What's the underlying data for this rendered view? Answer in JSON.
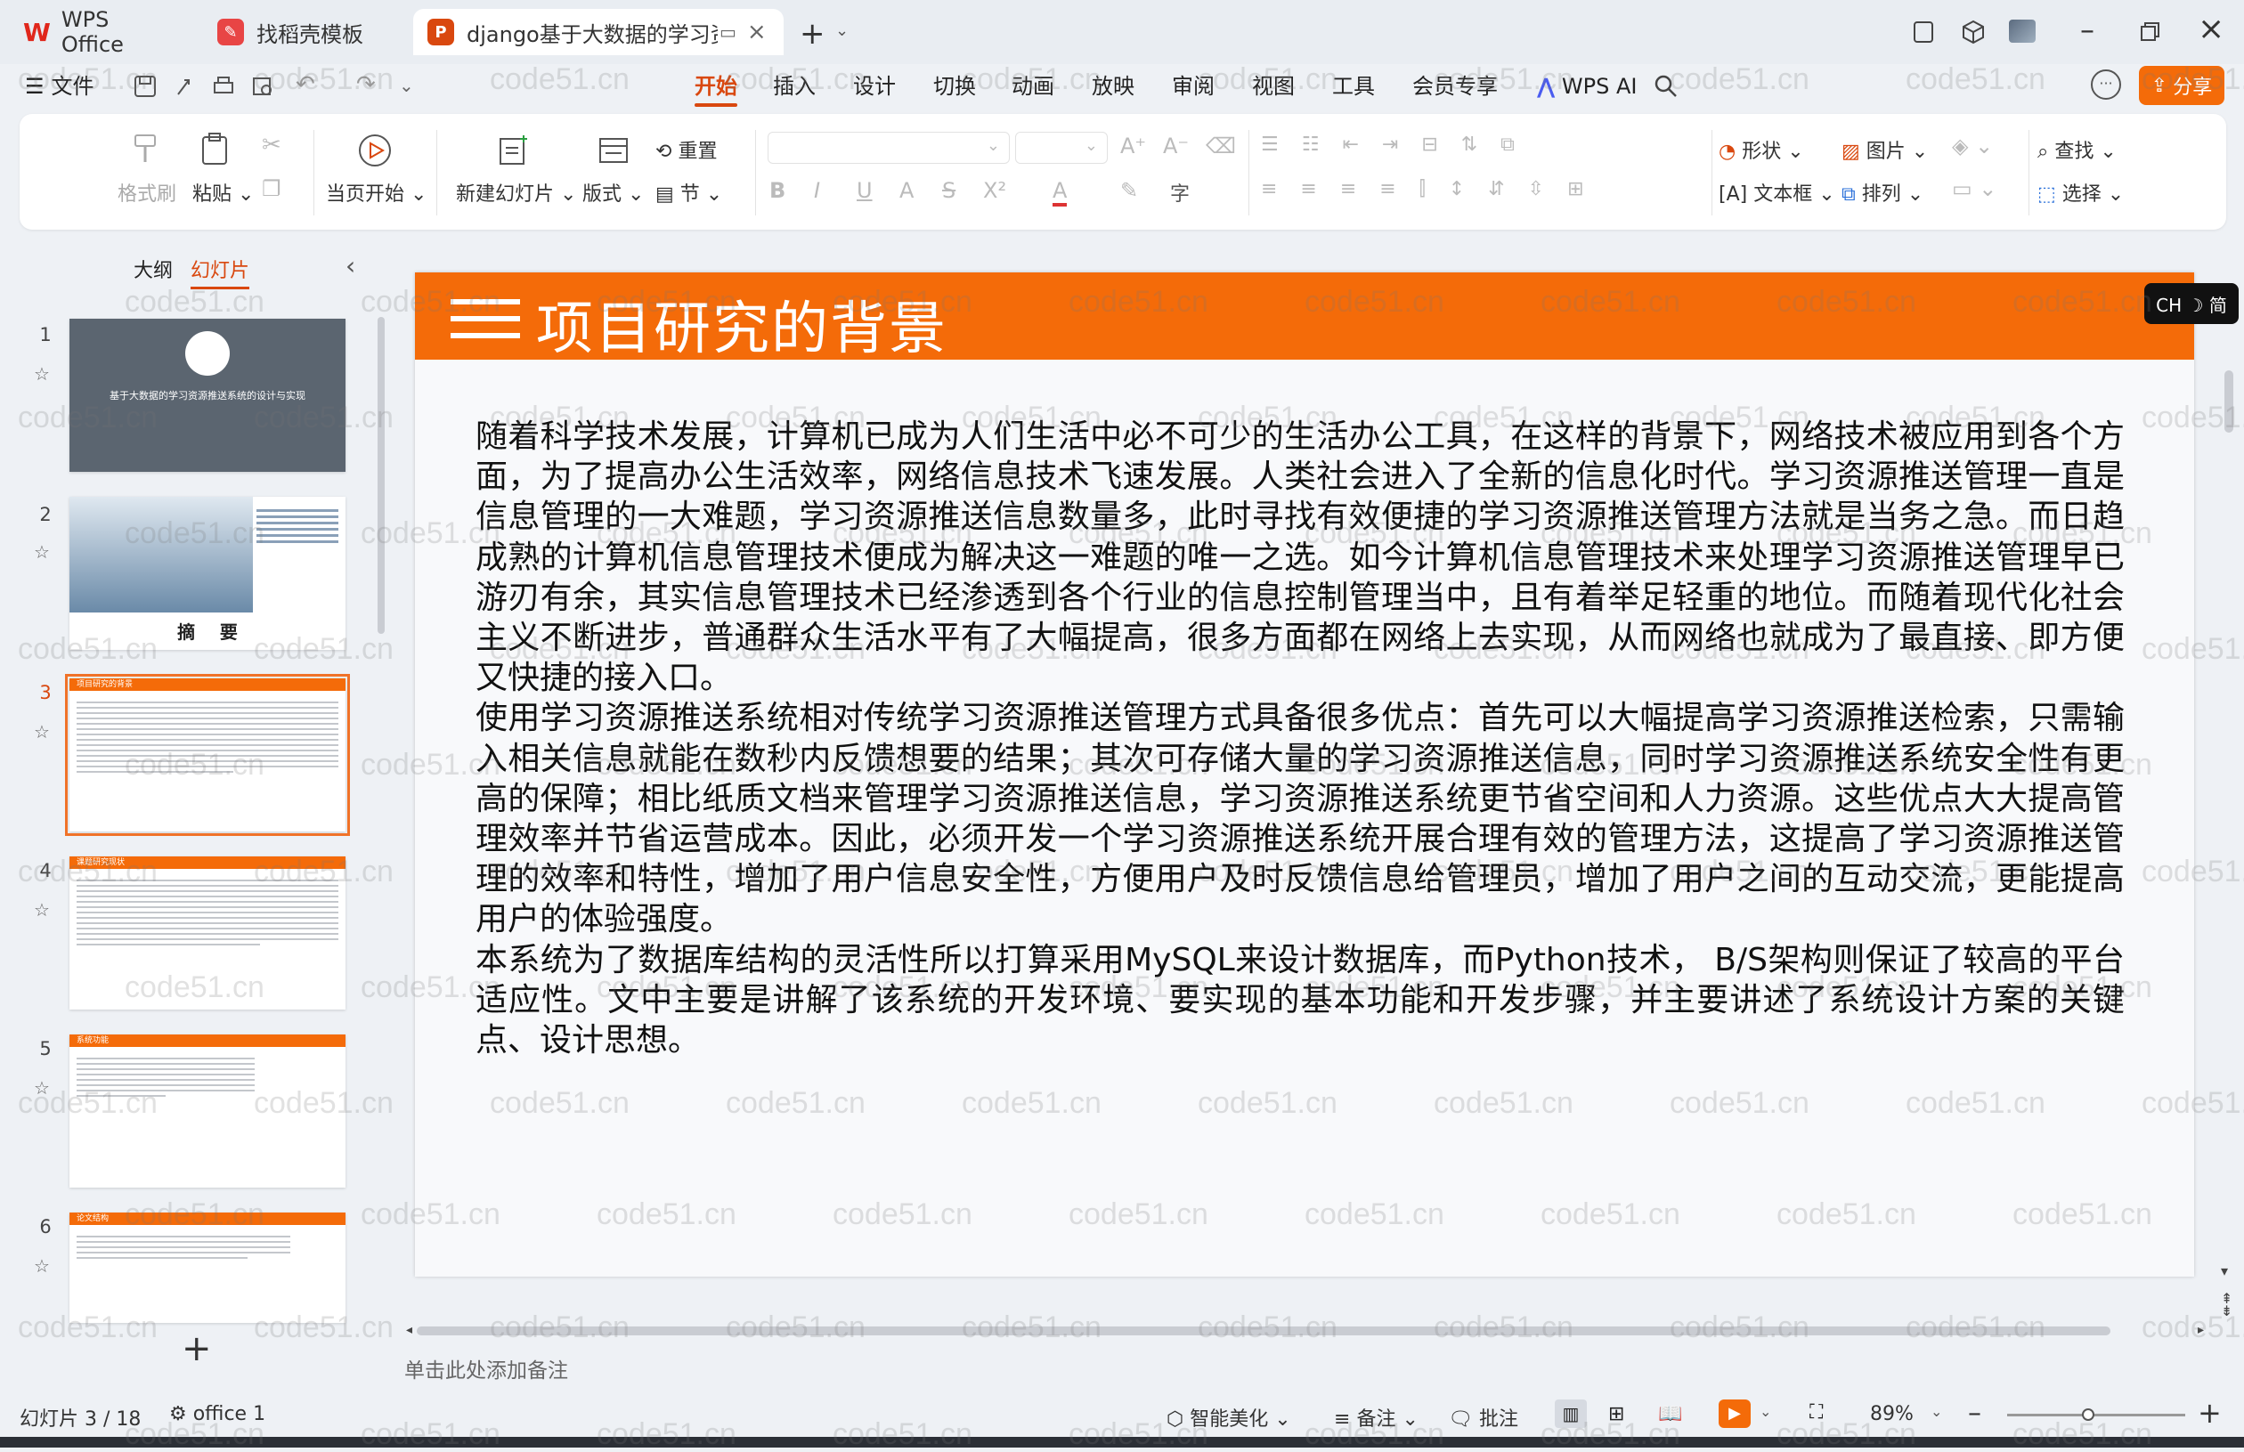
{
  "titlebar": {
    "tabs": [
      {
        "label": "WPS Office",
        "icon": "wps-logo-icon"
      },
      {
        "label": "找稻壳模板",
        "icon": "docer-icon"
      },
      {
        "label": "django基于大数据的学习资源",
        "icon": "presentation-file-icon"
      }
    ]
  },
  "menubar": {
    "file": "文件",
    "items": [
      "开始",
      "插入",
      "设计",
      "切换",
      "动画",
      "放映",
      "审阅",
      "视图",
      "工具",
      "会员专享"
    ],
    "active": "开始",
    "wps_ai": "WPS AI",
    "share": "分享"
  },
  "ribbon": {
    "format_painter": "格式刷",
    "paste": "粘贴",
    "play_from_current": "当页开始",
    "new_slide": "新建幻灯片",
    "layout": "版式",
    "reset": "重置",
    "section": "节",
    "shape": "形状",
    "picture": "图片",
    "find": "查找",
    "textbox": "文本框",
    "arrange": "排列",
    "select": "选择"
  },
  "left_panel": {
    "tab_outline": "大纲",
    "tab_slides": "幻灯片",
    "slides": [
      {
        "num": "1",
        "title": "基于大数据的学习资源推送系统的设计与实现"
      },
      {
        "num": "2",
        "title": "摘    要"
      },
      {
        "num": "3",
        "title": "项目研究的背景"
      },
      {
        "num": "4",
        "title": "课题研究现状"
      },
      {
        "num": "5",
        "title": "系统功能"
      },
      {
        "num": "6",
        "title": "论文结构"
      }
    ],
    "active_index": 2
  },
  "slide": {
    "title": "项目研究的背景",
    "paragraphs": [
      "随着科学技术发展，计算机已成为人们生活中必不可少的生活办公工具，在这样的背景下，网络技术被应用到各个方面，为了提高办公生活效率，网络信息技术飞速发展。人类社会进入了全新的信息化时代。学习资源推送管理一直是信息管理的一大难题，学习资源推送信息数量多，此时寻找有效便捷的学习资源推送管理方法就是当务之急。而日趋成熟的计算机信息管理技术便成为解决这一难题的唯一之选。如今计算机信息管理技术来处理学习资源推送管理早已游刃有余，其实信息管理技术已经渗透到各个行业的信息控制管理当中，且有着举足轻重的地位。而随着现代化社会主义不断进步，普通群众生活水平有了大幅提高，很多方面都在网络上去实现，从而网络也就成为了最直接、即方便又快捷的接入口。",
      "使用学习资源推送系统相对传统学习资源推送管理方式具备很多优点：首先可以大幅提高学习资源推送检索，只需输入相关信息就能在数秒内反馈想要的结果；其次可存储大量的学习资源推送信息，同时学习资源推送系统安全性有更高的保障；相比纸质文档来管理学习资源推送信息，学习资源推送系统更节省空间和人力资源。这些优点大大提高管理效率并节省运营成本。因此，必须开发一个学习资源推送系统开展合理有效的管理方法，这提高了学习资源推送管理的效率和特性，增加了用户信息安全性，方便用户及时反馈信息给管理员，增加了用户之间的互动交流，更能提高用户的体验强度。",
      "本系统为了数据库结构的灵活性所以打算采用MySQL来设计数据库，而Python技术， B/S架构则保证了较高的平台适应性。文中主要是讲解了该系统的开发环境、要实现的基本功能和开发步骤，并主要讲述了系统设计方案的关键点、设计思想。"
    ]
  },
  "ime_badge": "CH ☽ 简",
  "watermark": "code51.cn",
  "notes_placeholder": "单击此处添加备注",
  "status": {
    "slide_counter": "幻灯片 3 / 18",
    "theme": "office 1",
    "smart_beautify": "智能美化",
    "notes": "备注",
    "comments": "批注",
    "zoom": "89%"
  },
  "colors": {
    "accent": "#d9480f",
    "slide_header": "#f46b09",
    "share_button": "#f46b09"
  }
}
